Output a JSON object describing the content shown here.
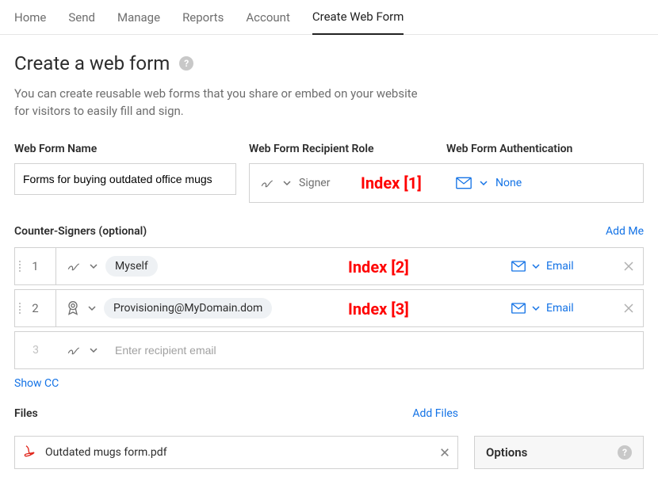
{
  "tabs": {
    "home": "Home",
    "send": "Send",
    "manage": "Manage",
    "reports": "Reports",
    "account": "Account",
    "create": "Create Web Form"
  },
  "title": "Create a web form",
  "subtitle": "You can create reusable web forms that you share or embed on your website for visitors to easily fill and sign.",
  "name_section": {
    "label": "Web Form Name",
    "value": "Forms for buying outdated office mugs"
  },
  "role_section": {
    "label": "Web Form Recipient Role",
    "role_value": "Signer"
  },
  "auth_section": {
    "label": "Web Form Authentication",
    "auth_value": "None"
  },
  "index_labels": {
    "i1": "Index [1]",
    "i2": "Index [2]",
    "i3": "Index [3]"
  },
  "counter": {
    "label": "Counter-Signers (optional)",
    "add_me": "Add Me",
    "rows": [
      {
        "num": "1",
        "chip": "Myself",
        "auth": "Email"
      },
      {
        "num": "2",
        "chip": "Provisioning@MyDomain.dom",
        "auth": "Email"
      }
    ],
    "placeholder_num": "3",
    "placeholder_text": "Enter recipient email",
    "show_cc": "Show CC"
  },
  "files": {
    "label": "Files",
    "add": "Add Files",
    "item": "Outdated mugs form.pdf"
  },
  "options": {
    "label": "Options"
  }
}
